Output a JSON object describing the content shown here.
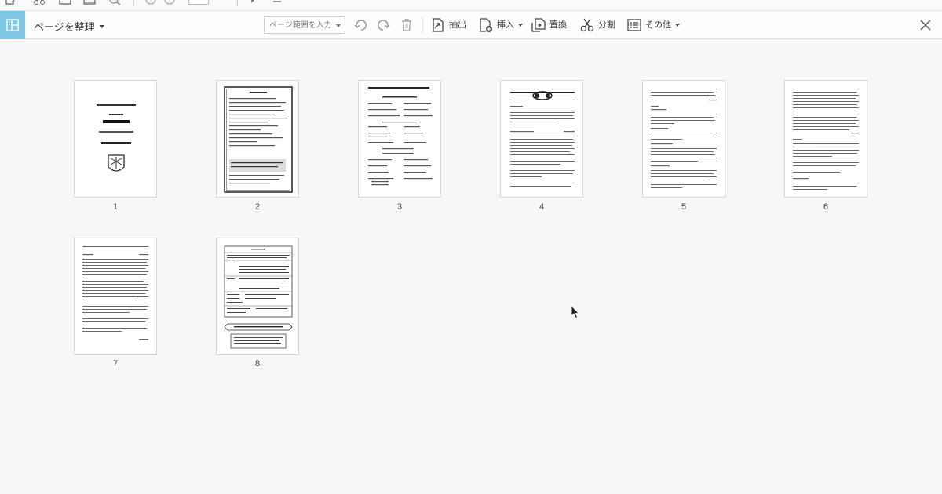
{
  "toolbar_top": {
    "icons": [
      "page-edit-icon",
      "scissors-icon",
      "print-icon",
      "mail-icon",
      "zoom-icon",
      "prev-page-icon",
      "next-page-icon",
      "page-number-field",
      "comment-icon",
      "sign-icon"
    ]
  },
  "organize_bar": {
    "title": "ページを整理",
    "range_placeholder": "ページ範囲を入力",
    "extract_label": "抽出",
    "insert_label": "挿入",
    "replace_label": "置換",
    "split_label": "分割",
    "more_label": "その他"
  },
  "pages": [
    {
      "number": "1"
    },
    {
      "number": "2"
    },
    {
      "number": "3"
    },
    {
      "number": "4"
    },
    {
      "number": "5"
    },
    {
      "number": "6"
    },
    {
      "number": "7"
    },
    {
      "number": "8"
    }
  ],
  "colors": {
    "accent": "#7fc6e4",
    "background": "#f7f7f7"
  }
}
